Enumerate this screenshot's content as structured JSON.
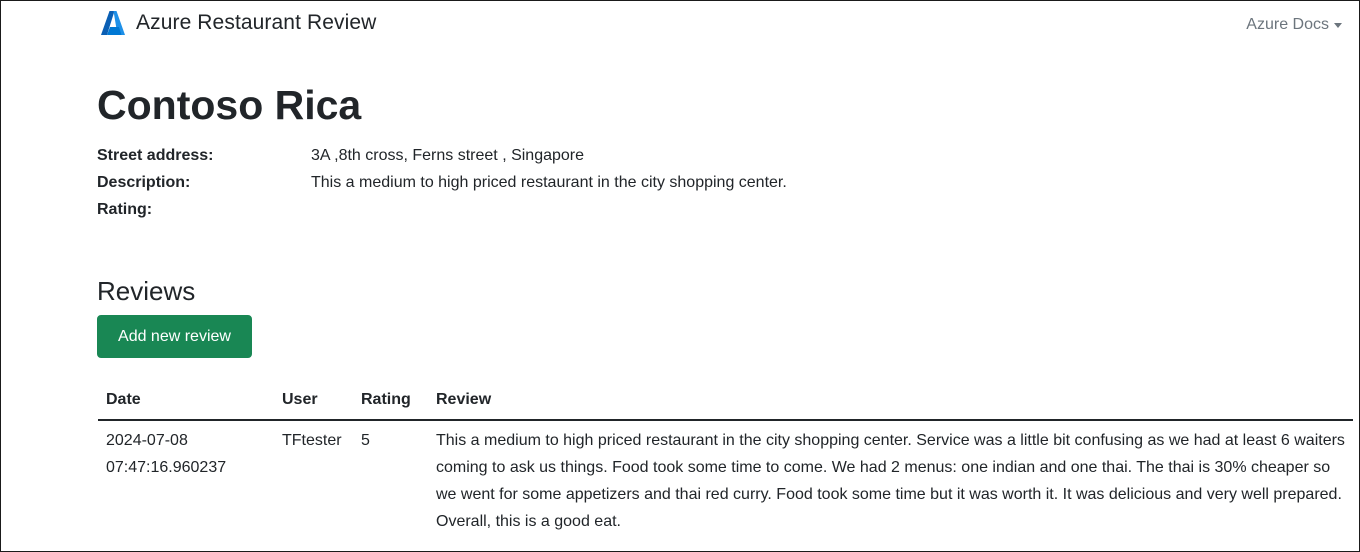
{
  "nav": {
    "brand": "Azure Restaurant Review",
    "docs_label": "Azure Docs",
    "brand_color": "#0078d4"
  },
  "restaurant": {
    "name": "Contoso Rica",
    "fields": [
      {
        "label": "Street address:",
        "value": "3A ,8th cross, Ferns street , Singapore"
      },
      {
        "label": "Description:",
        "value": "This a medium to high priced restaurant in the city shopping center."
      },
      {
        "label": "Rating:",
        "value": ""
      }
    ]
  },
  "reviews": {
    "title": "Reviews",
    "add_button_label": "Add new review",
    "button_color": "#198754",
    "columns": [
      "Date",
      "User",
      "Rating",
      "Review"
    ],
    "rows": [
      {
        "date": "2024-07-08 07:47:16.960237",
        "user": "TFtester",
        "rating": "5",
        "review": "This a medium to high priced restaurant in the city shopping center. Service was a little bit confusing as we had at least 6 waiters coming to ask us things. Food took some time to come. We had 2 menus: one indian and one thai. The thai is 30% cheaper so we went for some appetizers and thai red curry. Food took some time but it was worth it. It was delicious and very well prepared. Overall, this is a good eat."
      }
    ]
  }
}
